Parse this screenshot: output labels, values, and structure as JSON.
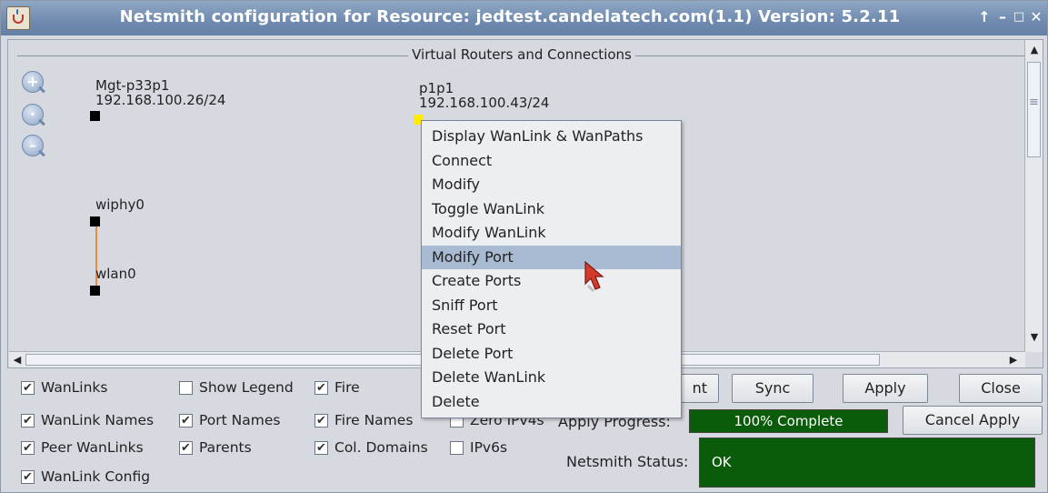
{
  "window": {
    "title": "Netsmith configuration for Resource: jedtest.candelatech.com(1.1) Version: 5.2.11",
    "controls": [
      "↑",
      "–",
      "□",
      "✕"
    ]
  },
  "canvas": {
    "section_title": "Virtual Routers and Connections",
    "zoom": [
      {
        "name": "zoom-in-icon",
        "glyph": "+"
      },
      {
        "name": "zoom-reset-icon",
        "glyph": "·"
      },
      {
        "name": "zoom-out-icon",
        "glyph": "–"
      }
    ],
    "nodes": [
      {
        "name": "Mgt-p33p1",
        "ip": "192.168.100.26/24"
      },
      {
        "name": "p1p1",
        "ip": "192.168.100.43/24"
      },
      {
        "name": "wiphy0"
      },
      {
        "name": "wlan0"
      }
    ],
    "link_color": "#f08a3c"
  },
  "context_menu": {
    "items": [
      "Display WanLink & WanPaths",
      "Connect",
      "Modify",
      "Toggle WanLink",
      "Modify WanLink",
      "Modify Port",
      "Create Ports",
      "Sniff Port",
      "Reset Port",
      "Delete Port",
      "Delete WanLink",
      "Delete"
    ],
    "highlighted": "Modify Port"
  },
  "options": {
    "wanlinks": {
      "label": "WanLinks",
      "checked": true
    },
    "show_legend": {
      "label": "Show Legend",
      "checked": false
    },
    "fire": {
      "label": "Fire",
      "checked": true
    },
    "wanlink_names": {
      "label": "WanLink Names",
      "checked": true
    },
    "port_names": {
      "label": "Port Names",
      "checked": true
    },
    "fire_names": {
      "label": "Fire Names",
      "checked": true
    },
    "zero_ipv4": {
      "label": "Zero IPv4s",
      "checked": false
    },
    "peer_wanlinks": {
      "label": "Peer WanLinks",
      "checked": true
    },
    "parents": {
      "label": "Parents",
      "checked": true
    },
    "col_domains": {
      "label": "Col. Domains",
      "checked": true
    },
    "ipv6s": {
      "label": "IPv6s",
      "checked": false
    },
    "wanlink_config": {
      "label": "WanLink Config",
      "checked": true
    }
  },
  "buttons": {
    "partial_left": "nt",
    "sync": "Sync",
    "apply": "Apply",
    "close": "Close",
    "cancel_apply": "Cancel Apply"
  },
  "apply_progress": {
    "label": "Apply Progress:",
    "value_text": "100% Complete",
    "percent": 100
  },
  "netsmith_status": {
    "label": "Netsmith Status:",
    "value": "OK"
  },
  "colors": {
    "status_green": "#0a5c0a",
    "menu_highlight": "#a9bbd3",
    "title_bar": "#6f8aae"
  }
}
